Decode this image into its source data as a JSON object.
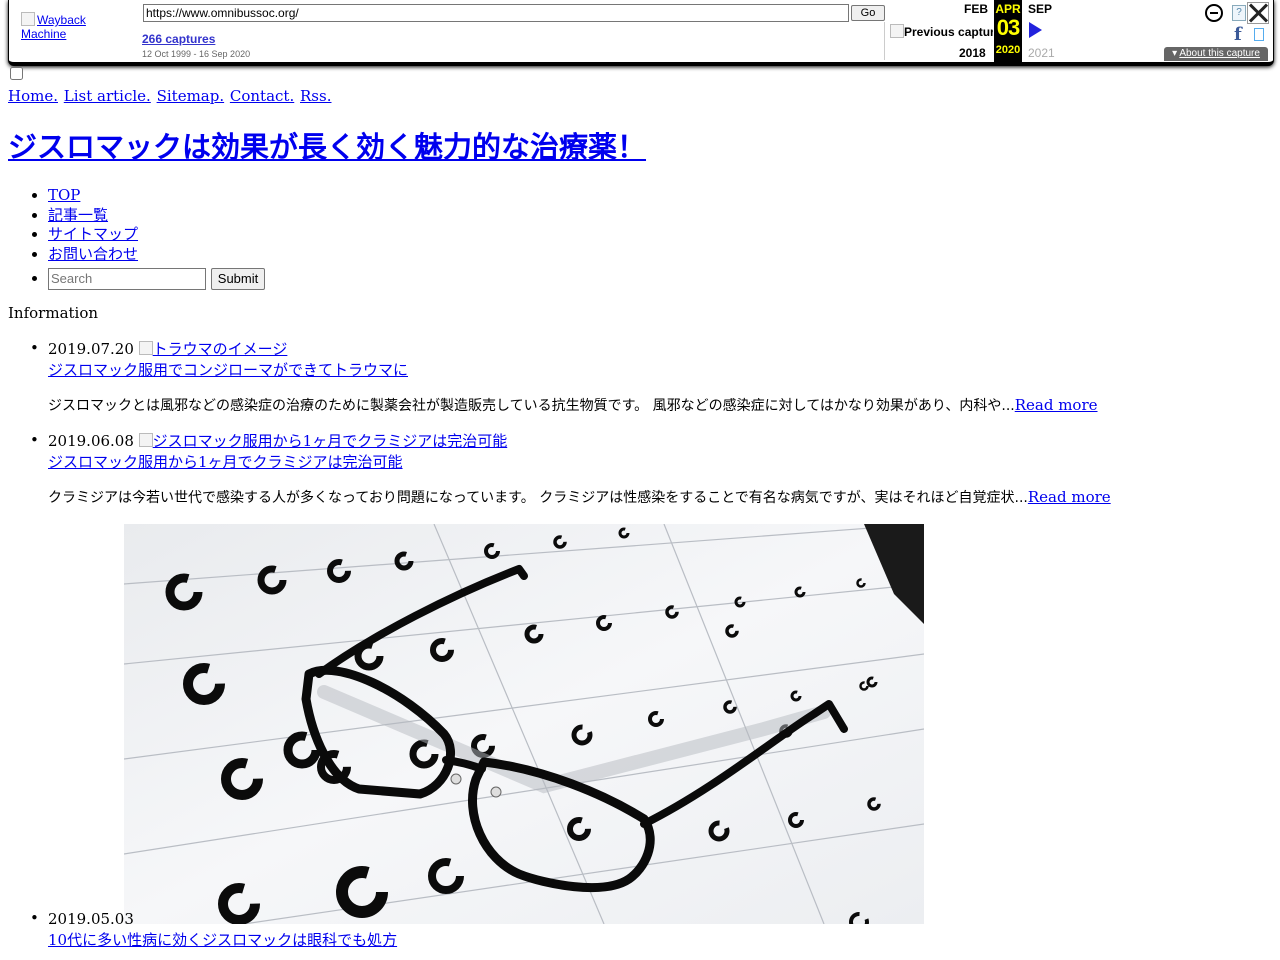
{
  "wayback": {
    "logo_alt": "Wayback Machine",
    "url_value": "https://www.omnibussoc.org/",
    "go_label": "Go",
    "captures_label": "266 captures",
    "date_range": "12 Oct 1999 - 16 Sep 2020",
    "prev_capture_alt": "Previous capture",
    "prev_month": "FEB",
    "current_month": "APR",
    "next_month": "SEP",
    "current_day": "03",
    "prev_year": "2018",
    "current_year": "2020",
    "next_year": "2021",
    "about_label": "About this capture",
    "about_arrow": "▾",
    "facebook_glyph": "f",
    "accent_color": "#ffff00"
  },
  "topnav": {
    "items": [
      "Home.",
      "List article.",
      "Sitemap.",
      "Contact.",
      "Rss."
    ]
  },
  "site": {
    "title": "ジスロマックは効果が長く効く魅力的な治療薬！"
  },
  "global_nav": {
    "items": [
      "TOP",
      "記事一覧",
      "サイトマップ",
      "お問い合わせ"
    ],
    "search_placeholder": "Search",
    "submit_label": "Submit"
  },
  "information": {
    "heading": "Information",
    "read_more": "Read more",
    "posts": [
      {
        "date": "2019.07.20",
        "image_alt": "トラウマのイメージ",
        "title": "ジスロマック服用でコンジローマができてトラウマに",
        "excerpt": "ジスロマックとは風邪などの感染症の治療のために製薬会社が製造販売している抗生物質です。 風邪などの感染症に対してはかなり効果があり、内科や..."
      },
      {
        "date": "2019.06.08",
        "image_alt": "ジスロマック服用から1ヶ月でクラミジアは完治可能",
        "title": "ジスロマック服用から1ヶ月でクラミジアは完治可能",
        "excerpt": "クラミジアは今若い世代で感染する人が多くなっており問題になっています。 クラミジアは性感染をすることで有名な病気ですが、実はそれほど自覚症状..."
      },
      {
        "date": "2019.05.03",
        "title": "10代に多い性病に効くジスロマックは眼科でも処方"
      }
    ]
  }
}
